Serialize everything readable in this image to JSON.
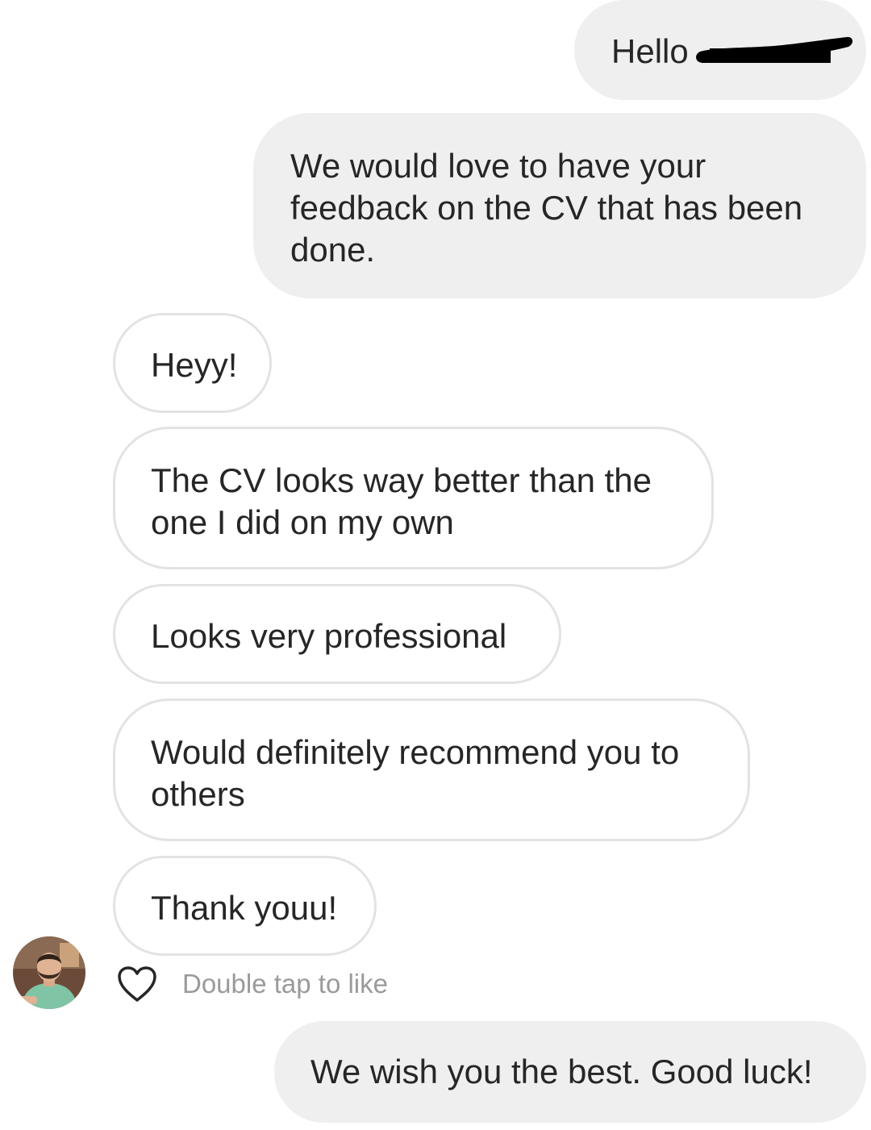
{
  "conversation": {
    "messages": [
      {
        "sender": "business",
        "text": "Hello",
        "redacted": true
      },
      {
        "sender": "business",
        "text": "We would love to have your feedback on the CV that has been done."
      },
      {
        "sender": "customer",
        "text": "Heyy!"
      },
      {
        "sender": "customer",
        "text": "The CV looks way better than the one I did on my own"
      },
      {
        "sender": "customer",
        "text": "Looks very professional"
      },
      {
        "sender": "customer",
        "text": "Would definitely recommend you to others"
      },
      {
        "sender": "customer",
        "text": "Thank youu!"
      },
      {
        "sender": "business",
        "text": "We wish you the best. Good luck!"
      }
    ],
    "like_prompt": {
      "icon": "heart-outline-icon",
      "text": "Double tap to like"
    }
  },
  "colors": {
    "sent_bubble": "#efefef",
    "received_border": "#e3e3e3",
    "text": "#262626",
    "hint_text": "#9a9a9a"
  }
}
